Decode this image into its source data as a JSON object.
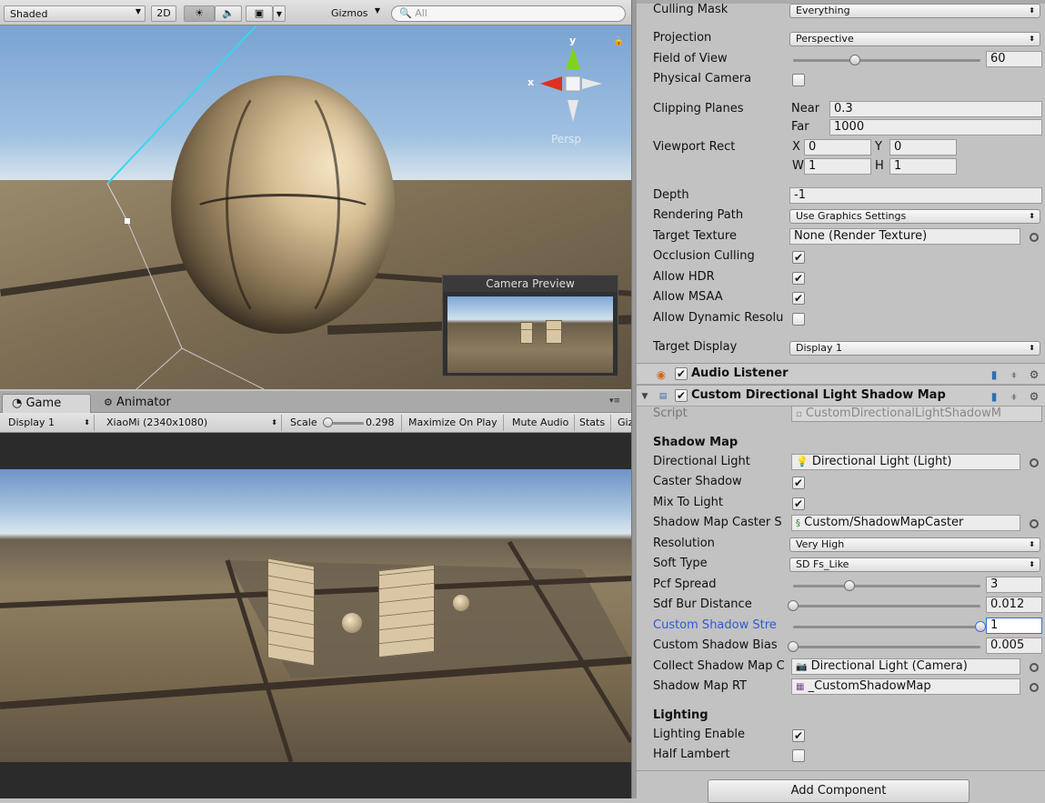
{
  "scene_toolbar": {
    "draw_mode": "Shaded",
    "mode_2d": "2D",
    "gizmos": "Gizmos",
    "search_placeholder": "All"
  },
  "scene_view": {
    "gizmo_y": "y",
    "gizmo_x": "x",
    "persp_label": "Persp",
    "camera_preview_title": "Camera Preview"
  },
  "game_tabs": {
    "game": "Game",
    "animator": "Animator"
  },
  "game_toolbar": {
    "display": "Display 1",
    "resolution": "XiaoMi (2340x1080)",
    "scale_label": "Scale",
    "scale_value": "0.298",
    "scale_fraction": 0.05,
    "maximize": "Maximize On Play",
    "mute": "Mute Audio",
    "stats": "Stats",
    "gizmos": "Gizmos"
  },
  "camera": {
    "culling_mask_label": "Culling Mask",
    "culling_mask_value": "Everything",
    "projection_label": "Projection",
    "projection_value": "Perspective",
    "fov_label": "Field of View",
    "fov_value": "60",
    "fov_fraction": 0.33,
    "physical_label": "Physical Camera",
    "clipping_label": "Clipping Planes",
    "near_label": "Near",
    "near_value": "0.3",
    "far_label": "Far",
    "far_value": "1000",
    "viewport_label": "Viewport Rect",
    "vp_x_label": "X",
    "vp_x": "0",
    "vp_y_label": "Y",
    "vp_y": "0",
    "vp_w_label": "W",
    "vp_w": "1",
    "vp_h_label": "H",
    "vp_h": "1",
    "depth_label": "Depth",
    "depth_value": "-1",
    "rendering_path_label": "Rendering Path",
    "rendering_path_value": "Use Graphics Settings",
    "target_texture_label": "Target Texture",
    "target_texture_value": "None (Render Texture)",
    "occlusion_label": "Occlusion Culling",
    "hdr_label": "Allow HDR",
    "msaa_label": "Allow MSAA",
    "dynres_label": "Allow Dynamic Resolu",
    "target_display_label": "Target Display",
    "target_display_value": "Display 1"
  },
  "audio_listener": {
    "title": "Audio Listener"
  },
  "shadow_component": {
    "title": "Custom Directional Light Shadow Map",
    "script_label": "Script",
    "script_value": "CustomDirectionalLightShadowM",
    "section_shadow": "Shadow Map",
    "directional_light_label": "Directional Light",
    "directional_light_value": "Directional Light (Light)",
    "caster_shadow_label": "Caster Shadow",
    "mix_light_label": "Mix To Light",
    "caster_shader_label": "Shadow Map Caster S",
    "caster_shader_value": "Custom/ShadowMapCaster",
    "resolution_label": "Resolution",
    "resolution_value": "Very High",
    "soft_type_label": "Soft Type",
    "soft_type_value": "SD Fs_Like",
    "pcf_label": "Pcf Spread",
    "pcf_value": "3",
    "pcf_fraction": 0.3,
    "sdf_label": "Sdf Bur Distance",
    "sdf_value": "0.012",
    "sdf_fraction": 0.0,
    "strength_label": "Custom Shadow Stre",
    "strength_value": "1",
    "strength_fraction": 1.0,
    "bias_label": "Custom Shadow Bias",
    "bias_value": "0.005",
    "bias_fraction": 0.0,
    "collect_label": "Collect Shadow Map C",
    "collect_value": "Directional Light (Camera)",
    "rt_label": "Shadow Map RT",
    "rt_value": "_CustomShadowMap",
    "section_lighting": "Lighting",
    "lighting_enable_label": "Lighting Enable",
    "half_lambert_label": "Half Lambert"
  },
  "add_component": "Add Component",
  "checked_mark": "✔"
}
